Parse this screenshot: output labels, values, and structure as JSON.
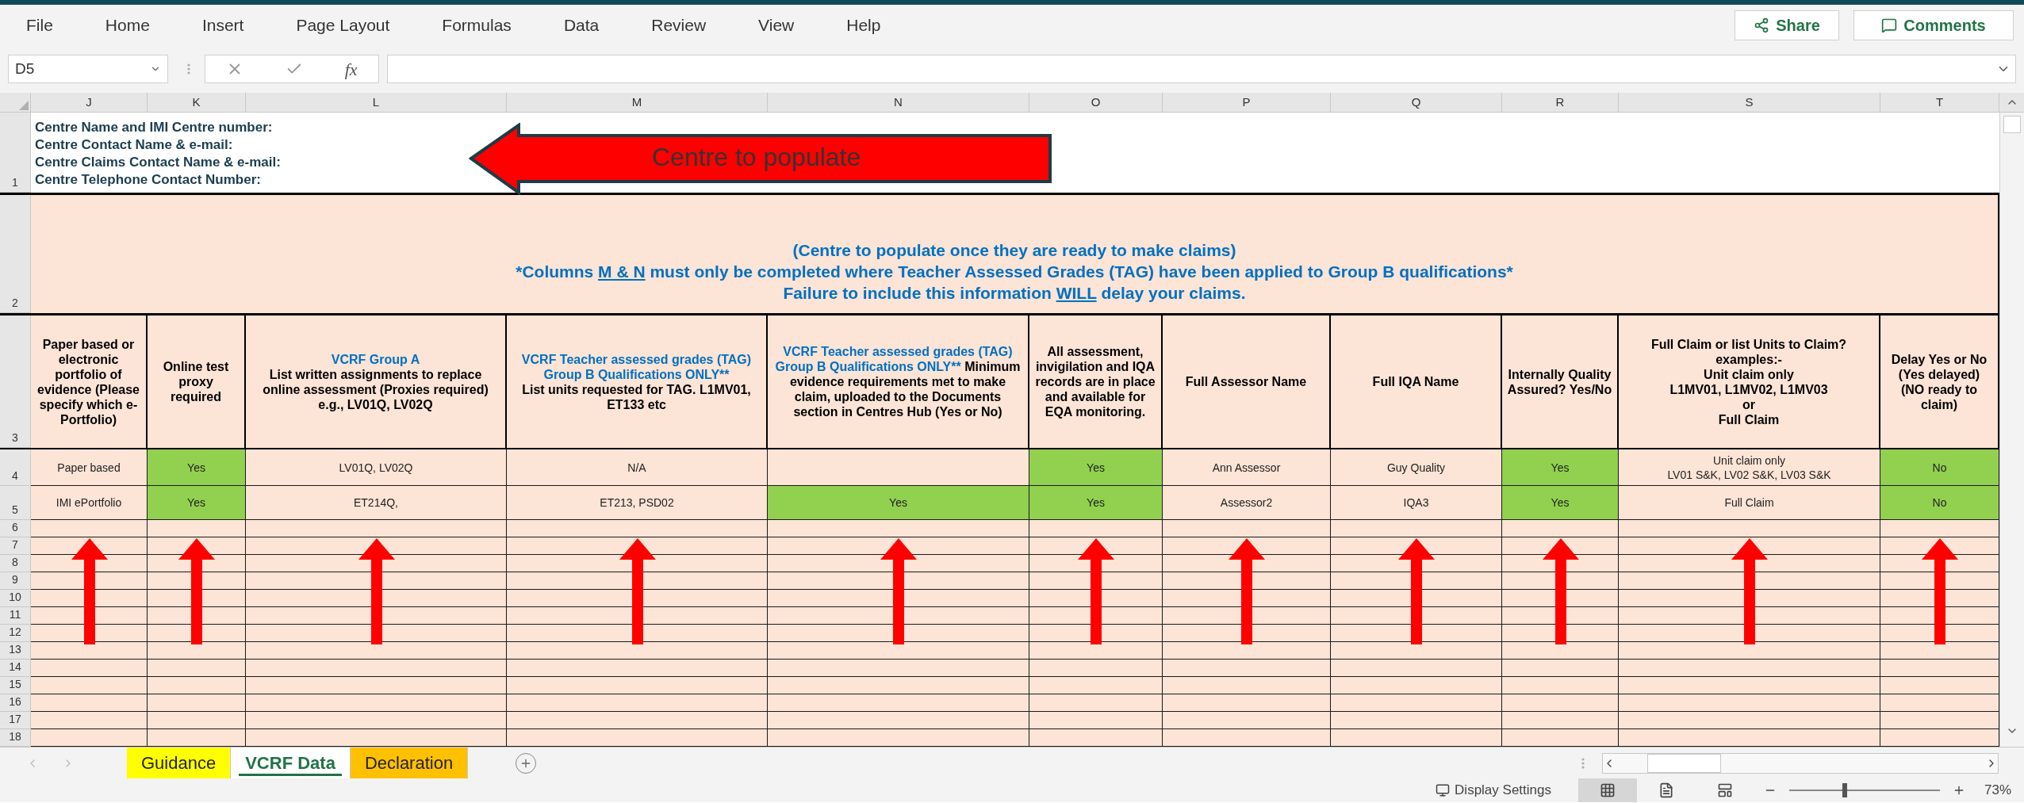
{
  "menu": {
    "items": [
      "File",
      "Home",
      "Insert",
      "Page Layout",
      "Formulas",
      "Data",
      "Review",
      "View",
      "Help"
    ],
    "share": "Share",
    "comments": "Comments"
  },
  "formula_bar": {
    "name_box": "D5",
    "fx": "fx"
  },
  "columns": [
    "J",
    "K",
    "L",
    "M",
    "N",
    "O",
    "P",
    "Q",
    "R",
    "S",
    "T"
  ],
  "row1": {
    "number": "1",
    "lines": [
      "Centre Name and IMI Centre number:",
      "Centre Contact Name & e-mail:",
      "Centre Claims Contact Name & e-mail:",
      "Centre Telephone Contact Number:"
    ],
    "arrow_label": "Centre to populate"
  },
  "row2": {
    "number": "2",
    "parts": [
      {
        "text": "(Centre to populate once they are ready to make claims)\n*Columns ",
        "underline": false
      },
      {
        "text": "M & N",
        "underline": true
      },
      {
        "text": " must only be completed where Teacher Assessed Grades (TAG) have been applied to Group B qualifications*\nFailure to include this information ",
        "underline": false
      },
      {
        "text": "WILL",
        "underline": true
      },
      {
        "text": " delay your claims.",
        "underline": false
      }
    ]
  },
  "row3": {
    "number": "3",
    "headers": [
      {
        "parts": [
          {
            "text": "Paper based or electronic portfolio of evidence (Please specify which e-Portfolio)",
            "accent": false
          }
        ]
      },
      {
        "parts": [
          {
            "text": "Online test proxy required",
            "accent": false
          }
        ]
      },
      {
        "parts": [
          {
            "text": "VCRF Group A",
            "accent": true
          },
          {
            "text": "\nList written assignments to replace online assessment (Proxies required) e.g., LV01Q, LV02Q",
            "accent": false
          }
        ]
      },
      {
        "parts": [
          {
            "text": "VCRF Teacher assessed grades (TAG) Group B Qualifications ONLY**",
            "accent": true
          },
          {
            "text": "\nList units requested for TAG. L1MV01, ET133 etc",
            "accent": false
          }
        ]
      },
      {
        "parts": [
          {
            "text": "VCRF Teacher assessed grades (TAG) Group B Qualifications ONLY**",
            "accent": true
          },
          {
            "text": " Minimum evidence requirements met to make claim, uploaded to the Documents section in Centres Hub  (Yes or No)",
            "accent": false
          }
        ]
      },
      {
        "parts": [
          {
            "text": "All assessment, invigilation and IQA records are in place and available for EQA monitoring.",
            "accent": false
          }
        ]
      },
      {
        "parts": [
          {
            "text": "Full Assessor Name",
            "accent": false
          }
        ]
      },
      {
        "parts": [
          {
            "text": "Full IQA Name",
            "accent": false
          }
        ]
      },
      {
        "parts": [
          {
            "text": "Internally Quality Assured? Yes/No",
            "accent": false
          }
        ]
      },
      {
        "parts": [
          {
            "text": "Full Claim or list Units to Claim?\nexamples:-\nUnit claim only\nL1MV01, L1MV02, L1MV03\nor\nFull Claim",
            "accent": false
          }
        ]
      },
      {
        "parts": [
          {
            "text": "Delay Yes or No\n(Yes delayed)\n(NO ready to claim)",
            "accent": false
          }
        ]
      }
    ]
  },
  "rows": [
    {
      "number": "4",
      "cells": [
        {
          "text": "Paper based",
          "highlighted": false
        },
        {
          "text": "Yes",
          "highlighted": true
        },
        {
          "text": "LV01Q, LV02Q",
          "highlighted": false
        },
        {
          "text": "N/A",
          "highlighted": false
        },
        {
          "highlighted": false
        },
        {
          "text": "Yes",
          "highlighted": true
        },
        {
          "text": "Ann Assessor",
          "highlighted": false
        },
        {
          "text": "Guy Quality",
          "highlighted": false
        },
        {
          "text": "Yes",
          "highlighted": true
        },
        {
          "text": "Unit claim only\nLV01 S&K, LV02 S&K, LV03 S&K",
          "highlighted": false
        },
        {
          "text": "No",
          "highlighted": true
        }
      ]
    },
    {
      "number": "5",
      "cells": [
        {
          "text": "IMI ePortfolio",
          "highlighted": false
        },
        {
          "text": "Yes",
          "highlighted": true
        },
        {
          "text": "ET214Q,",
          "highlighted": false
        },
        {
          "text": "ET213, PSD02",
          "highlighted": false
        },
        {
          "text": "Yes",
          "highlighted": true
        },
        {
          "text": "Yes",
          "highlighted": true
        },
        {
          "text": "Assessor2",
          "highlighted": false
        },
        {
          "text": "IQA3",
          "highlighted": false
        },
        {
          "text": "Yes",
          "highlighted": true
        },
        {
          "text": "Full Claim",
          "highlighted": false
        },
        {
          "text": "No",
          "highlighted": true
        }
      ]
    }
  ],
  "empty_rows": [
    "6",
    "7",
    "8",
    "9",
    "10",
    "11",
    "12",
    "13",
    "14",
    "15",
    "16",
    "17",
    "18"
  ],
  "sheet_tabs": [
    {
      "label": "Guidance",
      "color": "#ffff00",
      "selected": false
    },
    {
      "label": "VCRF Data",
      "color": "#217346",
      "selected": true
    },
    {
      "label": "Declaration",
      "color": "#ffc000",
      "selected": false
    }
  ],
  "status_bar": {
    "display_settings": "Display Settings",
    "zoom": "73%",
    "zoom_slider": {
      "level": 0.37
    }
  }
}
